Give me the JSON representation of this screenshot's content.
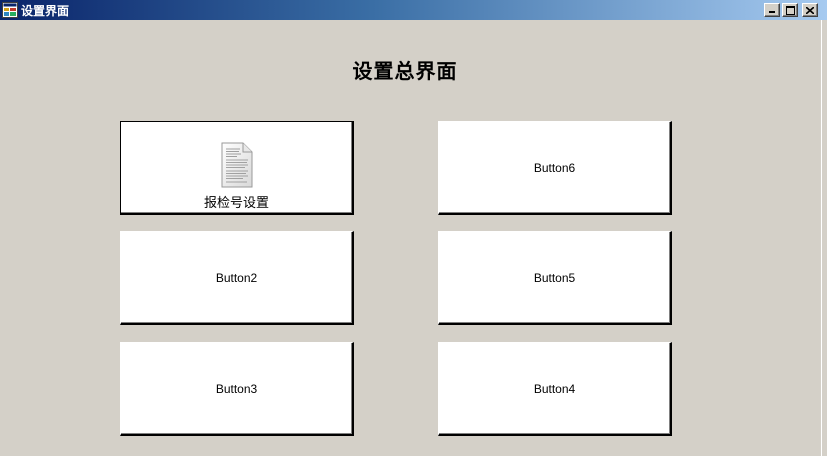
{
  "window": {
    "title": "设置界面",
    "caption_buttons": [
      "minimize",
      "maximize",
      "close"
    ]
  },
  "heading": "设置总界面",
  "buttons": {
    "b1": {
      "label": "报检号设置",
      "icon": "document-icon"
    },
    "b2": {
      "label": "Button2"
    },
    "b3": {
      "label": "Button3"
    },
    "b4": {
      "label": "Button4"
    },
    "b5": {
      "label": "Button5"
    },
    "b6": {
      "label": "Button6"
    }
  },
  "colors": {
    "form_background": "#d4d0c8",
    "titlebar_start": "#0a246a",
    "titlebar_end": "#a6caf0",
    "button_face": "#ffffff"
  }
}
